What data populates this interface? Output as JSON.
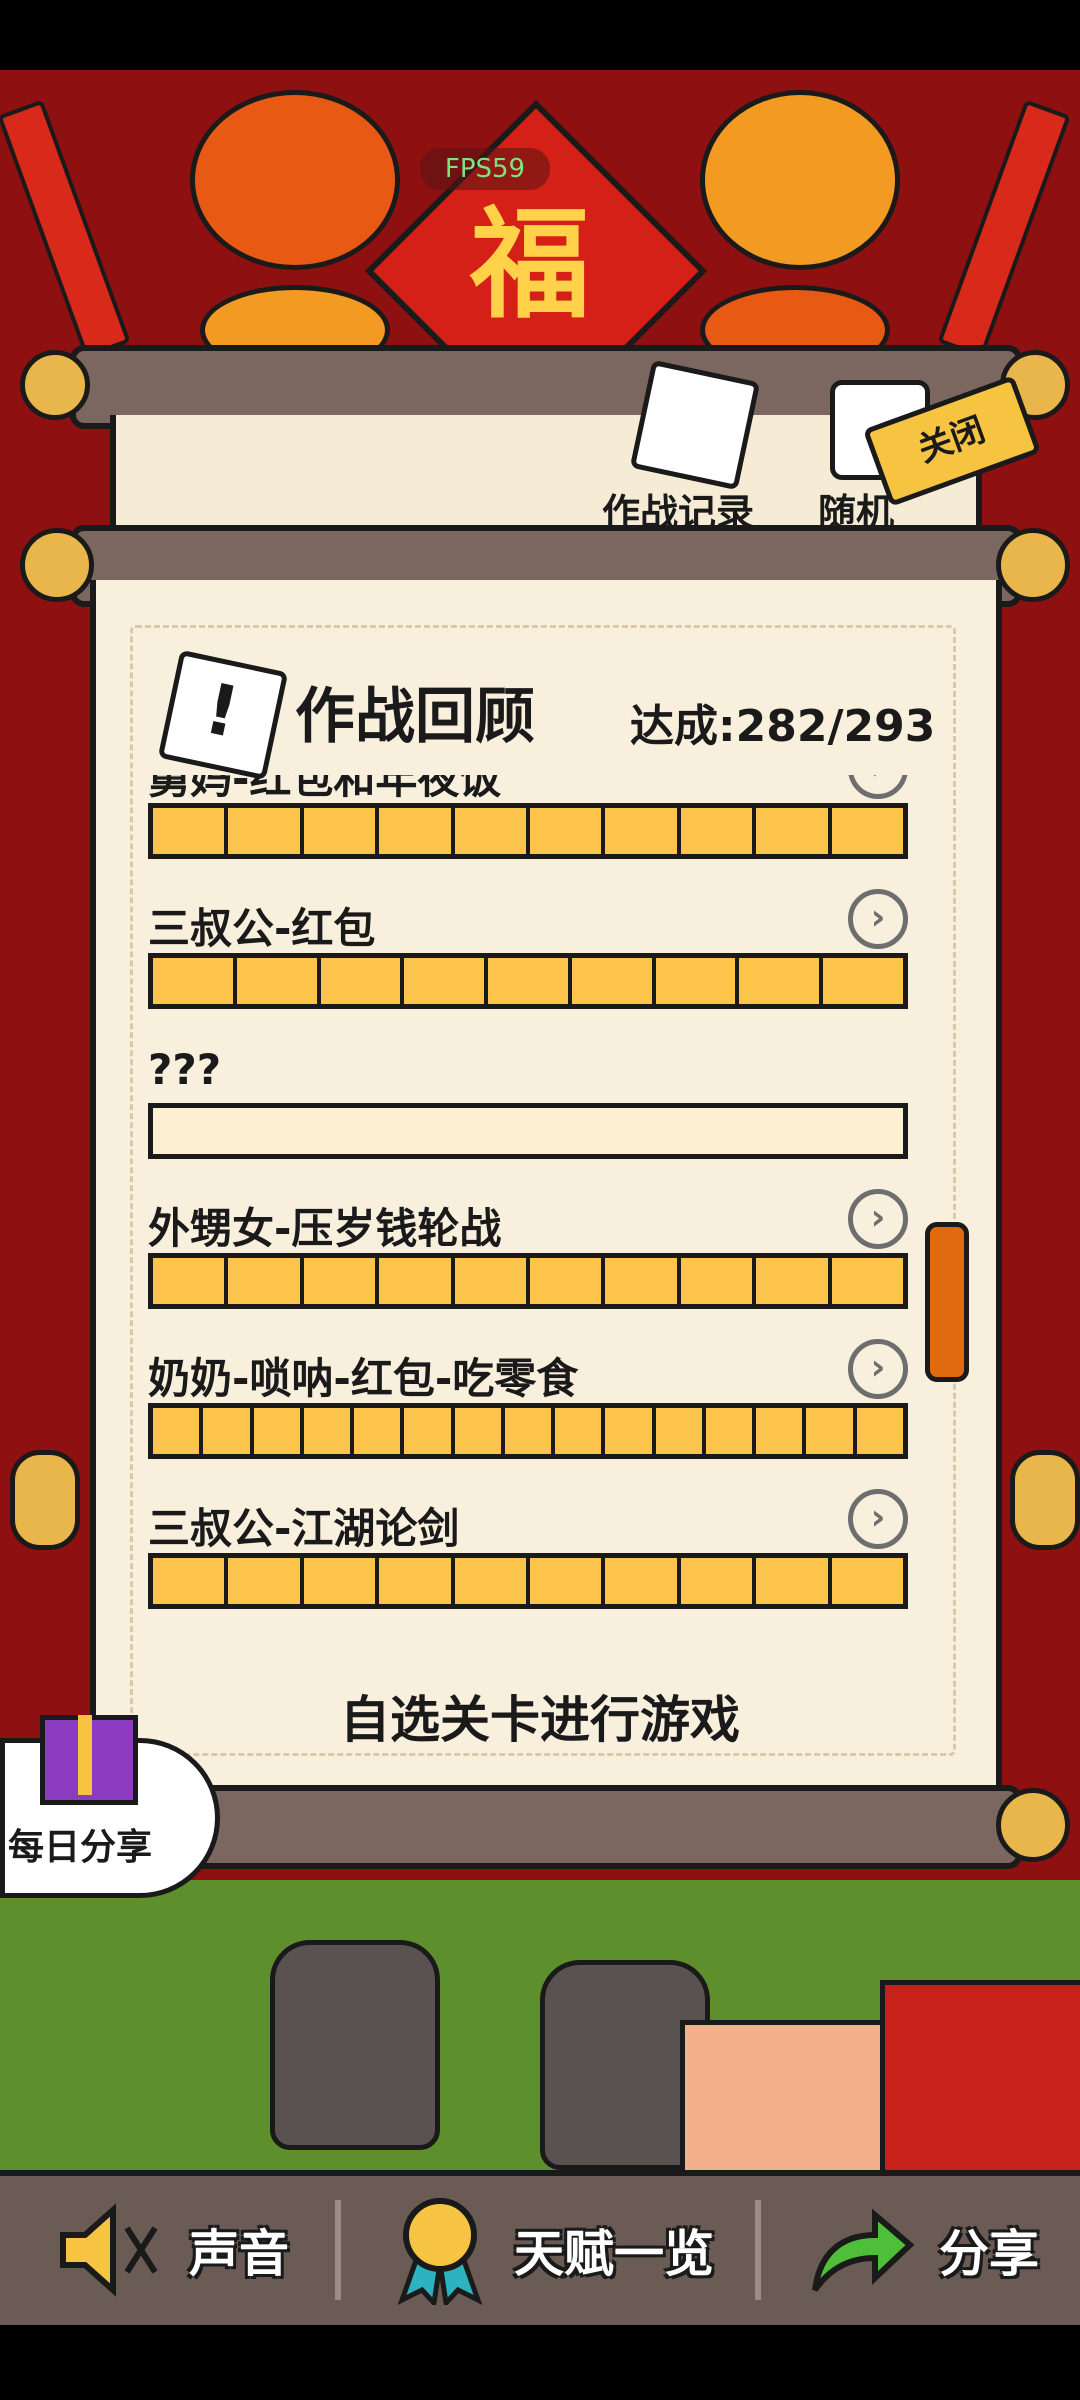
{
  "hud": {
    "fps": "FPS59"
  },
  "background": {
    "fu_char": "福"
  },
  "back_scroll": {
    "tabs": [
      {
        "label": "作战记录"
      },
      {
        "label": "随机"
      }
    ],
    "close_label": "关闭"
  },
  "panel": {
    "title": "作战回顾",
    "progress": "达成:282/293",
    "levels": [
      {
        "name": "舅妈-红包和年夜饭",
        "segments": 10,
        "filled": 10,
        "has_arrow": true
      },
      {
        "name": "三叔公-红包",
        "segments": 9,
        "filled": 9,
        "has_arrow": true
      },
      {
        "name": "???",
        "segments": 1,
        "filled": 0,
        "has_arrow": false
      },
      {
        "name": "外甥女-压岁钱轮战",
        "segments": 10,
        "filled": 10,
        "has_arrow": true
      },
      {
        "name": "奶奶-唢呐-红包-吃零食",
        "segments": 15,
        "filled": 15,
        "has_arrow": true
      },
      {
        "name": "三叔公-江湖论剑",
        "segments": 10,
        "filled": 10,
        "has_arrow": true
      }
    ],
    "select_label": "自选关卡进行游戏"
  },
  "daily_share": {
    "label": "每日分享"
  },
  "bottom_nav": {
    "sound_label": "声音",
    "talent_label": "天赋一览",
    "share_label": "分享"
  },
  "colors": {
    "progress_fill": "#fcc44b",
    "scrollbar": "#e06a10"
  }
}
